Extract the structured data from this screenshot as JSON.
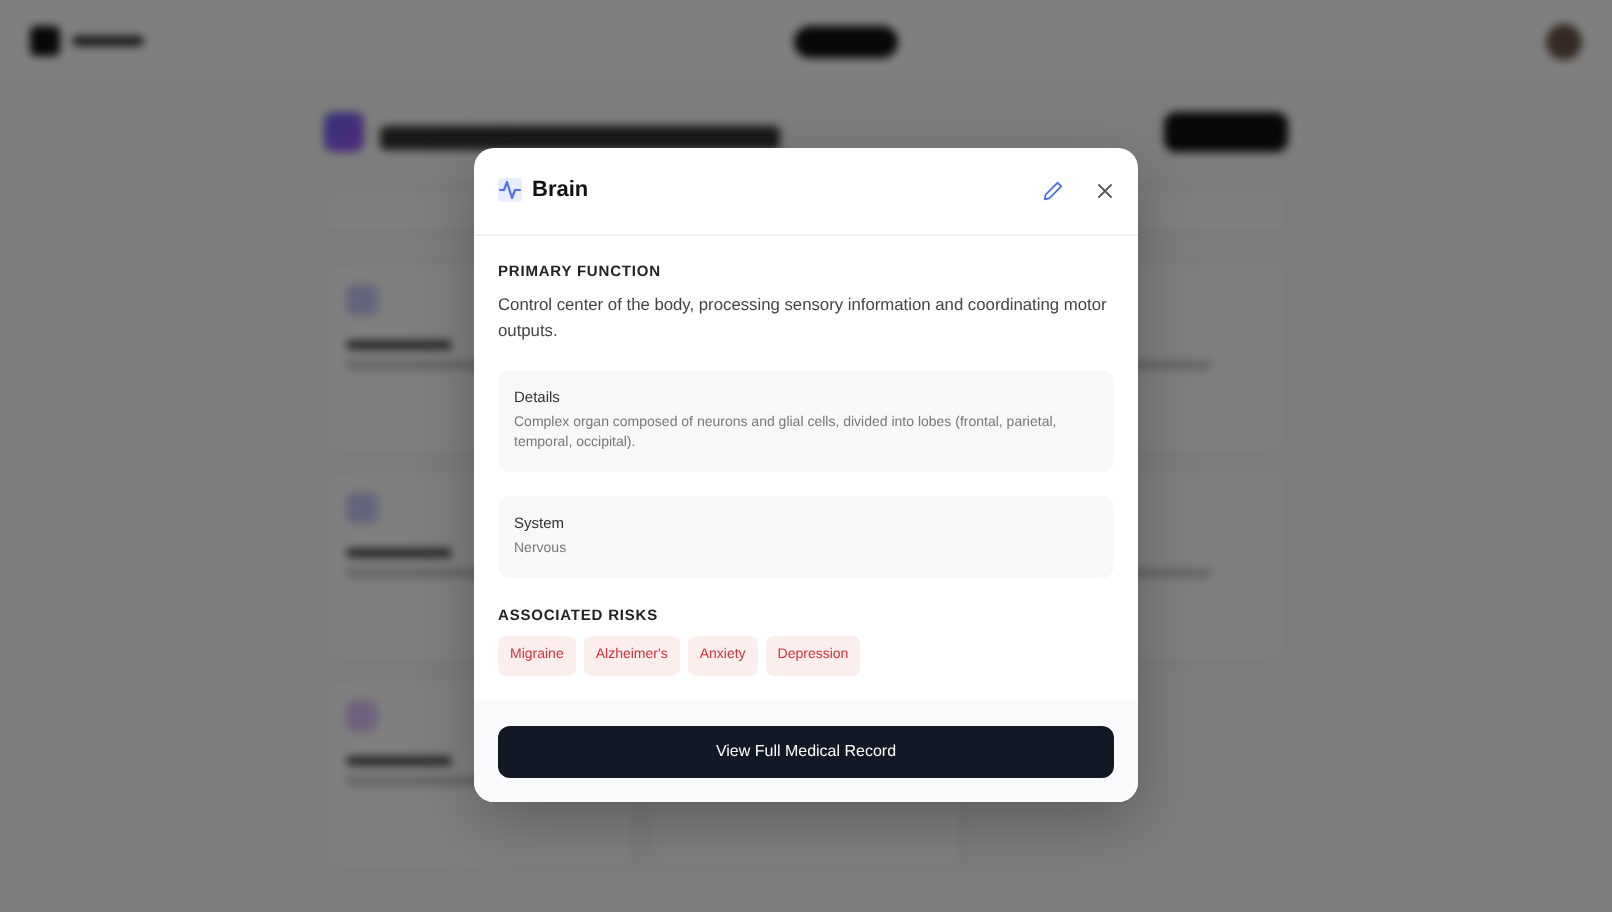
{
  "modal": {
    "title": "Brain",
    "primary_function_heading": "PRIMARY FUNCTION",
    "primary_function": "Control center of the body, processing sensory information and coordinating motor outputs.",
    "panels": [
      {
        "label": "Details",
        "value": "Complex organ composed of neurons and glial cells, divided into lobes (frontal, parietal, temporal, occipital)."
      },
      {
        "label": "System",
        "value": "Nervous"
      }
    ],
    "risks_heading": "ASSOCIATED RISKS",
    "risks": [
      "Migraine",
      "Alzheimer's",
      "Anxiety",
      "Depression"
    ],
    "footer_button": "View Full Medical Record"
  }
}
